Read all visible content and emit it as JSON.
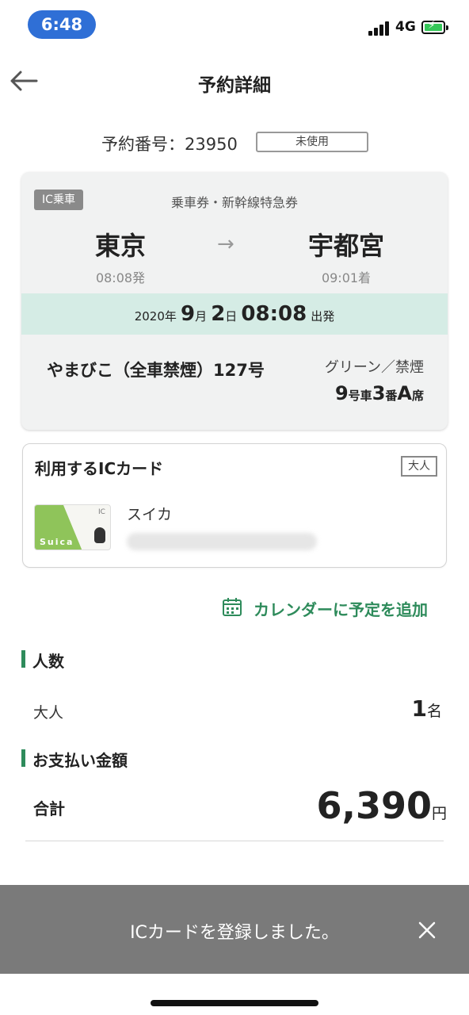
{
  "status_bar": {
    "time": "6:48",
    "network": "4G"
  },
  "header": {
    "title": "予約詳細"
  },
  "reservation": {
    "label": "予約番号：23950",
    "status_badge": "未使用"
  },
  "ticket": {
    "ic_tag": "IC乗車",
    "type": "乗車券・新幹線特急券",
    "from_station": "東京",
    "to_station": "宇都宮",
    "departure": "08:08発",
    "arrival": "09:01着",
    "date": {
      "year": "2020",
      "year_unit": "年",
      "month": "9",
      "month_unit": "月",
      "day": "2",
      "day_unit": "日",
      "time": "08:08",
      "dep_word": "出発"
    },
    "train": "やまびこ（全車禁煙）127号",
    "car_class": "グリーン／禁煙",
    "seat": {
      "car": "9",
      "car_unit": "号車",
      "row": "3",
      "row_unit": "番",
      "seat": "A",
      "seat_unit": "席"
    }
  },
  "ic_card": {
    "title": "利用するICカード",
    "fare_type": "大人",
    "card_name": "スイカ",
    "card_logo": "Suica"
  },
  "calendar": {
    "label": "カレンダーに予定を追加"
  },
  "passengers": {
    "section_title": "人数",
    "label": "大人",
    "count": "1",
    "unit": "名"
  },
  "payment": {
    "section_title": "お支払い金額",
    "label": "合計",
    "amount": "6,390",
    "unit": "円"
  },
  "toast": {
    "message": "ICカードを登録しました。"
  },
  "colors": {
    "accent_green": "#2e8b5b",
    "date_band": "#d5ece5",
    "status_pill": "#2f6fd6"
  }
}
